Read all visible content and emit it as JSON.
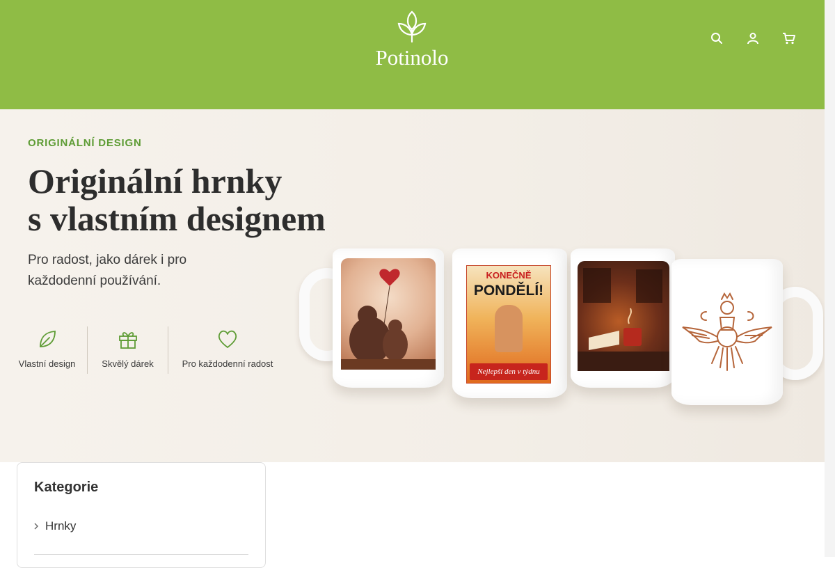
{
  "header": {
    "logo_text": "Potinolo",
    "brand_color": "#8fbc45",
    "icons": [
      {
        "name": "search-icon",
        "count": ""
      },
      {
        "name": "user-icon",
        "count": ""
      },
      {
        "name": "cart-icon",
        "count": ""
      }
    ]
  },
  "hero": {
    "eyebrow": "ORIGINÁLNÍ DESIGN",
    "title_line1": "Originální hrnky",
    "title_line2": "s vlastním designem",
    "subtitle_line1": "Pro radost, jako dárek i pro",
    "subtitle_line2": "každodenní používání.",
    "features": [
      {
        "icon": "leaf-icon",
        "label": "Vlastní design"
      },
      {
        "icon": "gift-icon",
        "label": "Skvělý dárek"
      },
      {
        "icon": "heart-icon",
        "label": "Pro každodenní radost"
      }
    ],
    "mugs": [
      {
        "name": "mug-bears"
      },
      {
        "name": "mug-monday",
        "headline": "KONEČNĚ",
        "main": "PONDĚLÍ!",
        "footer": "Nejlepší den v týdnu"
      },
      {
        "name": "mug-cozy"
      },
      {
        "name": "mug-farvahar"
      }
    ]
  },
  "sidebar": {
    "title": "Kategorie",
    "items": [
      {
        "label": "Hrnky"
      }
    ]
  }
}
